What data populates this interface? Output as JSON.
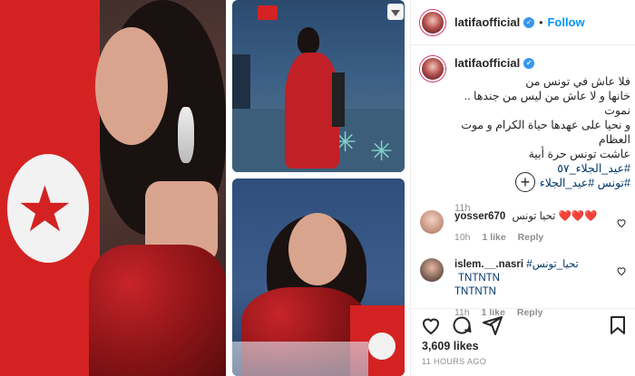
{
  "post": {
    "username": "latifaofficial",
    "follow_label": "Follow",
    "separator": "•",
    "caption_lines": [
      "فلا عاش في تونس من",
      "خانها و لا عاش من ليس من جندها .. نموت",
      "و نحيا على عهدها حياة الكرام و موت",
      "العظام",
      "عاشت تونس حرة أبية"
    ],
    "caption_tags": "#عيد_الجلاء_٥٧",
    "caption_tags2": "#تونس #عيد_الجلاء",
    "time": "11h",
    "load_more_symbol": "+",
    "likes": "3,609 likes",
    "time_ago": "11 HOURS AGO"
  },
  "comments": [
    {
      "user": "yosser670",
      "text": "تحيا تونس",
      "emoji": "❤️❤️❤️",
      "time": "10h",
      "likes": "1 like",
      "reply": "Reply"
    },
    {
      "user": "islem.__.nasri",
      "text": "#تحيا_تونس TNTNTN",
      "text2": "TNTNTN",
      "time": "11h",
      "likes": "1 like",
      "reply": "Reply"
    }
  ],
  "icons": {
    "verified": "verified-badge-icon",
    "like": "heart-icon",
    "comment": "comment-icon",
    "share": "share-icon",
    "save": "bookmark-icon",
    "download": "download-icon",
    "add": "plus-circle-icon"
  },
  "colors": {
    "accent": "#0095f6",
    "verified": "#3897f0",
    "muted": "#8e8e8e",
    "hashtag": "#00376b",
    "flag_red": "#d42222"
  }
}
